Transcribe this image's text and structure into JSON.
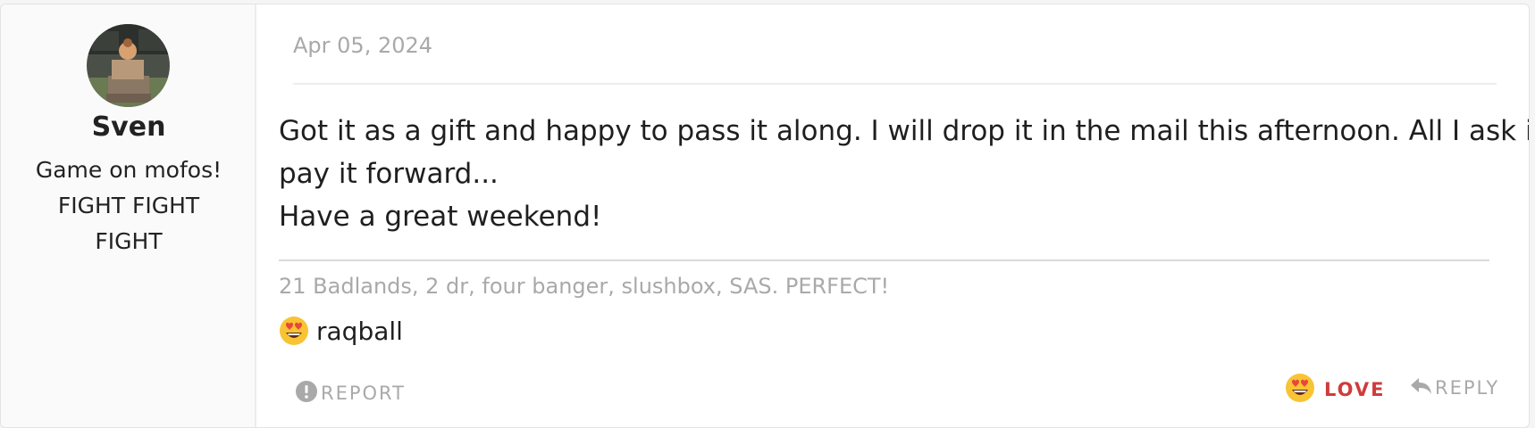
{
  "post": {
    "author": {
      "name": "Sven",
      "title": "Game on mofos! FIGHT FIGHT FIGHT",
      "avatar_icon": "avatar-photo"
    },
    "date": "Apr 05, 2024",
    "message": {
      "line1": "Got it as a gift and happy to pass it along. I will drop it in the mail this afternoon. All I ask is",
      "line2": "pay it forward...",
      "line3": "Have a great weekend!"
    },
    "signature": "21 Badlands, 2 dr, four banger, slushbox, SAS. PERFECT!",
    "reactions": {
      "emoji_icon": "heart-eyes-emoji-icon",
      "reactor": "raqball"
    },
    "actions": {
      "report_label": "REPORT",
      "report_icon": "exclamation-icon",
      "love_label": "LOVE",
      "love_icon": "heart-eyes-emoji-icon",
      "reply_label": "REPLY",
      "reply_icon": "reply-arrow-icon"
    }
  },
  "colors": {
    "love_accent": "#d13b3b",
    "muted_text": "#a9a9a9",
    "body_text": "#1f1f1f",
    "emoji_face": "#f8c434",
    "emoji_heart": "#e8463d"
  }
}
